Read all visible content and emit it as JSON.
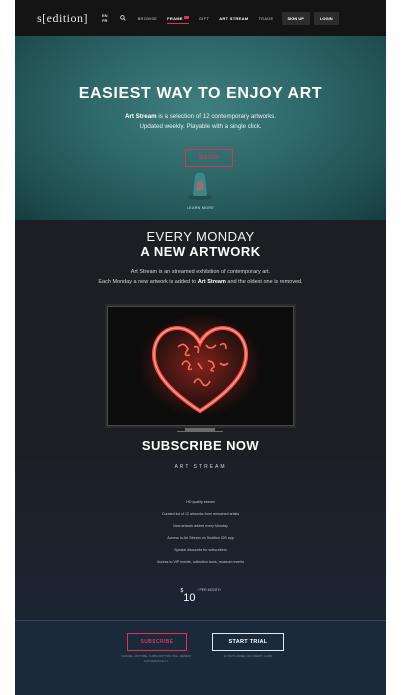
{
  "nav": {
    "logo": "s[edition]",
    "lang": [
      "EN",
      "FR"
    ],
    "links": [
      "BROWSE",
      "FRAME",
      "GIFT",
      "ART STREAM",
      "TRADE"
    ],
    "signup": "SIGN UP",
    "login": "LOGIN"
  },
  "hero": {
    "title": "EASIEST WAY TO ENJOY ART",
    "desc_bold": "Art Stream",
    "desc_rest": " is a selection of 12 contemporary artworks.",
    "desc_line2": "Updated weekly. Playable with a single click.",
    "cta": "WATCH",
    "learn_more": "LEARN MORE"
  },
  "monday": {
    "heading": "EVERY MONDAY",
    "subheading": "A NEW ARTWORK",
    "line1": "Art Stream is an streamed exhibition of contemporary art.",
    "line2_a": "Each Monday a new artwork is added to ",
    "line2_b": "Art Stream",
    "line2_c": " and the oldest one is removed.",
    "artwork": "neon heart artwork"
  },
  "subscribe": {
    "title": "SUBSCRIBE NOW",
    "subtitle": "ART STREAM",
    "features": [
      "HD quality stream",
      "Curated list of 12 artworks from renowned artists",
      "New artwork added every Monday",
      "Access to Art Stream on Sedition iOS app",
      "Special discounts for subscribers",
      "Access to VIP events, collection tours, museum events"
    ],
    "price_currency": "$",
    "price_amount": "10",
    "price_period": "/ PER MONTH"
  },
  "cta": {
    "subscribe": "SUBSCRIBE",
    "trial": "START TRIAL",
    "subscribe_note": "CANCEL ANYTIME, SUBSCRIPTION WILL RENEW AUTOMATICALLY",
    "trial_note": "14 DAYS FREE, NO CREDIT CARD"
  },
  "colors": {
    "accent": "#e0305a",
    "hero_teal": "#2d6667",
    "dark_bg": "#1c1e23"
  }
}
